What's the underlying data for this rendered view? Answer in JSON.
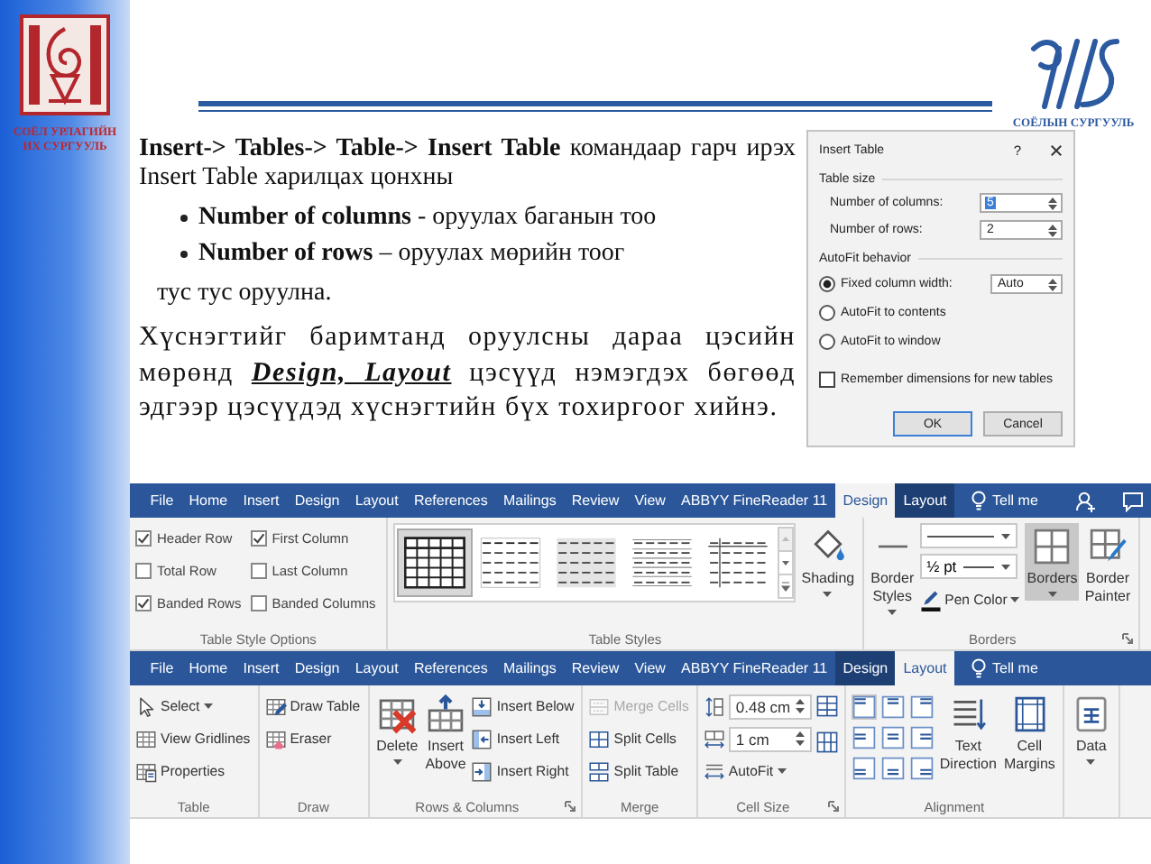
{
  "sidebar": {
    "logo_caption": [
      "СОЁЛ УРЛАГИЙН",
      "ИХ СУРГУУЛЬ"
    ]
  },
  "header": {
    "logo_caption": "СОЁЛЫН СУРГУУЛЬ"
  },
  "text": {
    "intro": "**Insert-> Tables-> Table-> Insert Table** командаар гарч ирэх Insert Table харилцах цонхны",
    "bullets": [
      "**Number of columns** -  оруулах баганын тоо",
      "**Number of rows** – оруулах мөрийн тоог"
    ],
    "closing": "тус тус оруулна.",
    "paragraph": "Хүснэгтийг баримтанд оруулсны дараа цэсийн мөрөнд **Design, Layout** цэсүүд нэмэгдэх бөгөөд эдгээр цэсүүдэд хүснэгтийн бүх тохиргоог хийнэ."
  },
  "dialog": {
    "title": "Insert Table",
    "help": "?",
    "table_size": {
      "heading": "Table size",
      "fields": [
        {
          "label": "Number of columns:",
          "value": "5",
          "focused": true
        },
        {
          "label": "Number of rows:",
          "value": "2",
          "focused": false
        }
      ]
    },
    "autofit": {
      "heading": "AutoFit behavior",
      "options": [
        {
          "label": "Fixed column width:",
          "selected": true,
          "value": "Auto"
        },
        {
          "label": "AutoFit to contents",
          "selected": false
        },
        {
          "label": "AutoFit to window",
          "selected": false
        }
      ]
    },
    "remember": {
      "label": "Remember dimensions for new tables",
      "checked": false
    },
    "buttons": [
      {
        "label": "OK",
        "default": true
      },
      {
        "label": "Cancel",
        "default": false
      }
    ]
  },
  "ribbons": [
    {
      "tabs": [
        {
          "label": "File",
          "selected": false,
          "contextual": false
        },
        {
          "label": "Home",
          "selected": false,
          "contextual": false
        },
        {
          "label": "Insert",
          "selected": false,
          "contextual": false
        },
        {
          "label": "Design",
          "selected": false,
          "contextual": false
        },
        {
          "label": "Layout",
          "selected": false,
          "contextual": false
        },
        {
          "label": "References",
          "selected": false,
          "contextual": false
        },
        {
          "label": "Mailings",
          "selected": false,
          "contextual": false
        },
        {
          "label": "Review",
          "selected": false,
          "contextual": false
        },
        {
          "label": "View",
          "selected": false,
          "contextual": false
        },
        {
          "label": "ABBYY FineReader 11",
          "selected": false,
          "contextual": false
        },
        {
          "label": "Design",
          "selected": true,
          "contextual": true
        },
        {
          "label": "Layout",
          "selected": false,
          "contextual": true
        }
      ],
      "tell_me": "Tell me",
      "share_icons": true,
      "groups": [
        {
          "label": "Table Style Options",
          "columns": [
            [
              {
                "kind": "check",
                "label": "Header Row",
                "checked": true
              },
              {
                "kind": "check",
                "label": "Total Row",
                "checked": false
              },
              {
                "kind": "check",
                "label": "Banded Rows",
                "checked": true
              }
            ],
            [
              {
                "kind": "check",
                "label": "First Column",
                "checked": true
              },
              {
                "kind": "check",
                "label": "Last Column",
                "checked": false
              },
              {
                "kind": "check",
                "label": "Banded Columns",
                "checked": false
              }
            ]
          ]
        },
        {
          "label": "Table Styles",
          "columns": [
            [
              {
                "kind": "gallery",
                "styles": [
                  {
                    "selected": true
                  },
                  {
                    "selected": false
                  },
                  {
                    "selected": false
                  },
                  {
                    "selected": false
                  },
                  {
                    "selected": false
                  }
                ]
              }
            ],
            [
              {
                "kind": "large",
                "label": "Shading",
                "dropdown": true
              }
            ]
          ]
        },
        {
          "label": "Borders",
          "launcher": true,
          "columns": [
            [
              {
                "kind": "large",
                "label": "Border Styles",
                "dropdown": true
              }
            ],
            [
              {
                "kind": "combo"
              },
              {
                "kind": "combo",
                "value": "½ pt"
              },
              {
                "kind": "small",
                "label": "Pen Color",
                "dropdown": true
              }
            ],
            [
              {
                "kind": "large",
                "label": "Borders",
                "dropdown": true,
                "selected": true
              }
            ],
            [
              {
                "kind": "large",
                "label": "Border Painter",
                "dropdown": false,
                "selected": false
              }
            ]
          ]
        }
      ]
    },
    {
      "tabs": [
        {
          "label": "File",
          "selected": false,
          "contextual": false
        },
        {
          "label": "Home",
          "selected": false,
          "contextual": false
        },
        {
          "label": "Insert",
          "selected": false,
          "contextual": false
        },
        {
          "label": "Design",
          "selected": false,
          "contextual": false
        },
        {
          "label": "Layout",
          "selected": false,
          "contextual": false
        },
        {
          "label": "References",
          "selected": false,
          "contextual": false
        },
        {
          "label": "Mailings",
          "selected": false,
          "contextual": false
        },
        {
          "label": "Review",
          "selected": false,
          "contextual": false
        },
        {
          "label": "View",
          "selected": false,
          "contextual": false
        },
        {
          "label": "ABBYY FineReader 11",
          "selected": false,
          "contextual": false
        },
        {
          "label": "Design",
          "selected": false,
          "contextual": true
        },
        {
          "label": "Layout",
          "selected": true,
          "contextual": true
        }
      ],
      "tell_me": "Tell me",
      "share_icons": false,
      "groups": [
        {
          "label": "Table",
          "columns": [
            [
              {
                "kind": "small",
                "label": "Select",
                "dropdown": true
              },
              {
                "kind": "small",
                "label": "View Gridlines"
              },
              {
                "kind": "small",
                "label": "Properties"
              }
            ]
          ]
        },
        {
          "label": "Draw",
          "columns": [
            [
              {
                "kind": "small",
                "label": "Draw Table"
              },
              {
                "kind": "small",
                "label": "Eraser"
              }
            ]
          ]
        },
        {
          "label": "Rows & Columns",
          "launcher": true,
          "columns": [
            [
              {
                "kind": "large",
                "label": "Delete",
                "dropdown": true
              }
            ],
            [
              {
                "kind": "large",
                "label": "Insert Above"
              }
            ],
            [
              {
                "kind": "small",
                "label": "Insert Below"
              },
              {
                "kind": "small",
                "label": "Insert Left"
              },
              {
                "kind": "small",
                "label": "Insert Right"
              }
            ]
          ]
        },
        {
          "label": "Merge",
          "columns": [
            [
              {
                "kind": "small",
                "label": "Merge Cells",
                "disabled": true
              },
              {
                "kind": "small",
                "label": "Split Cells",
                "disabled": false
              },
              {
                "kind": "small",
                "label": "Split Table",
                "disabled": false
              }
            ]
          ]
        },
        {
          "label": "Cell Size",
          "launcher": true,
          "columns": [
            [
              {
                "kind": "spinner",
                "value": "0.48 cm"
              },
              {
                "kind": "spinner",
                "value": "1 cm"
              },
              {
                "kind": "small",
                "label": "AutoFit",
                "dropdown": true
              }
            ],
            [
              {
                "kind": "icon"
              },
              {
                "kind": "icon"
              }
            ]
          ]
        },
        {
          "label": "Alignment",
          "columns": [
            [
              {
                "kind": "align-grid",
                "cells": [
                  {
                    "selected": true
                  },
                  {
                    "selected": false
                  },
                  {
                    "selected": false
                  },
                  {
                    "selected": false
                  },
                  {
                    "selected": false
                  },
                  {
                    "selected": false
                  },
                  {
                    "selected": false
                  },
                  {
                    "selected": false
                  },
                  {
                    "selected": false
                  }
                ]
              }
            ],
            [
              {
                "kind": "large",
                "label": "Text Direction"
              }
            ],
            [
              {
                "kind": "large",
                "label": "Cell Margins"
              }
            ]
          ]
        },
        {
          "columns": [
            [
              {
                "kind": "large",
                "label": "Data",
                "dropdown": true
              }
            ]
          ]
        }
      ]
    }
  ]
}
